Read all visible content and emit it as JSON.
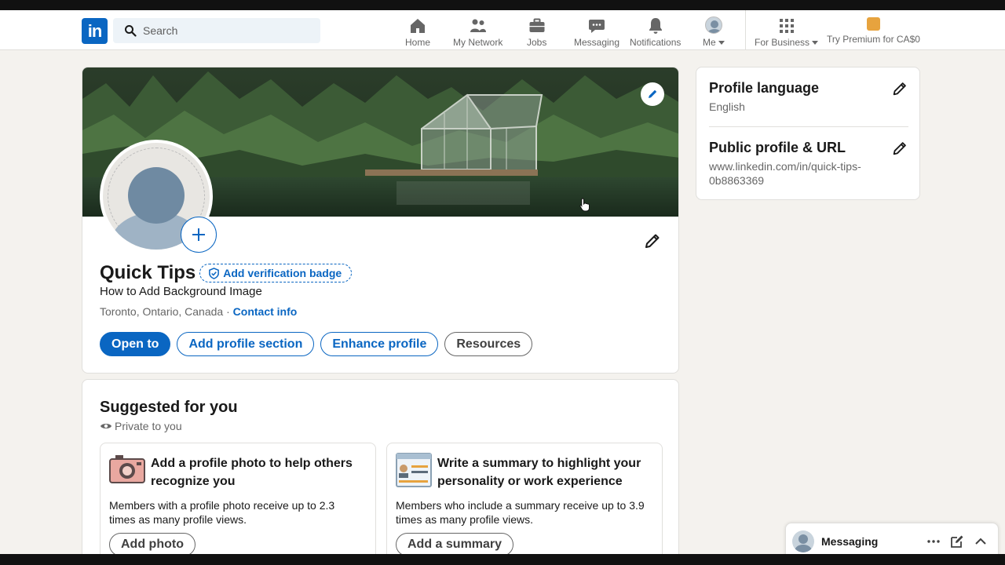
{
  "nav": {
    "logo_text": "in",
    "search_placeholder": "Search",
    "items": [
      {
        "label": "Home",
        "icon": "home-icon"
      },
      {
        "label": "My Network",
        "icon": "network-icon"
      },
      {
        "label": "Jobs",
        "icon": "briefcase-icon"
      },
      {
        "label": "Messaging",
        "icon": "messaging-icon"
      },
      {
        "label": "Notifications",
        "icon": "bell-icon"
      },
      {
        "label": "Me",
        "icon": "avatar"
      }
    ],
    "business_label": "For Business",
    "premium_label": "Try Premium for CA$0"
  },
  "profile": {
    "name": "Quick Tips",
    "verification_label": "Add verification badge",
    "headline": "How to Add Background Image",
    "location": "Toronto, Ontario, Canada",
    "separator": " · ",
    "contact_label": "Contact info",
    "buttons": {
      "open_to": "Open to",
      "add_section": "Add profile section",
      "enhance": "Enhance profile",
      "resources": "Resources"
    }
  },
  "suggested": {
    "title": "Suggested for you",
    "privacy": "Private to you",
    "cards": [
      {
        "icon": "camera-icon",
        "title": "Add a profile photo to help others recognize you",
        "description": "Members with a profile photo receive up to 2.3 times as many profile views.",
        "button": "Add photo"
      },
      {
        "icon": "summary-document-icon",
        "title": "Write a summary to highlight your personality or work experience",
        "description": "Members who include a summary receive up to 3.9 times as many profile views.",
        "button": "Add a summary"
      }
    ]
  },
  "sidebar": {
    "language_title": "Profile language",
    "language_value": "English",
    "url_title": "Public profile & URL",
    "url_value": "www.linkedin.com/in/quick-tips-0b8863369"
  },
  "messaging": {
    "label": "Messaging"
  },
  "colors": {
    "brand": "#0a66c2",
    "background": "#f4f2ee"
  }
}
